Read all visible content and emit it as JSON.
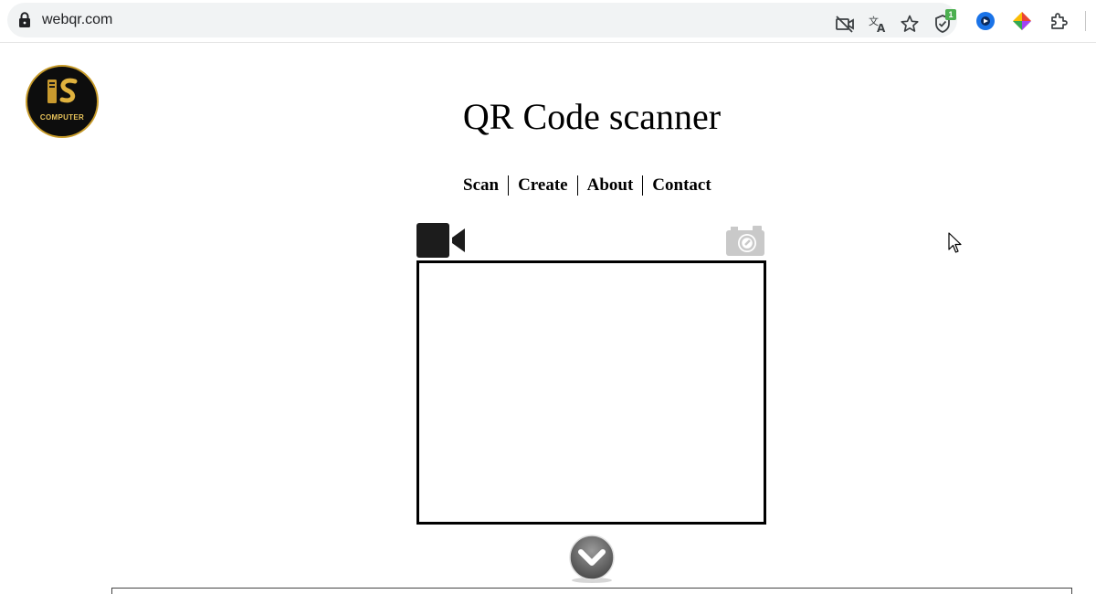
{
  "browser": {
    "url": "webqr.com",
    "icons": [
      "lock-icon",
      "camera-blocked-icon",
      "translate-icon",
      "bookmark-star-icon",
      "shield-extension-icon",
      "extension-blue-icon",
      "extension-colorful-icon",
      "puzzle-extensions-icon"
    ],
    "extension_badge": "1"
  },
  "page": {
    "logo_text": "COMPUTER",
    "title": "QR Code scanner",
    "nav": [
      "Scan",
      "Create",
      "About",
      "Contact"
    ],
    "icons": {
      "camera": "video-camera-icon",
      "photo": "photo-camera-icon",
      "down": "chevron-down-circle-icon"
    }
  }
}
